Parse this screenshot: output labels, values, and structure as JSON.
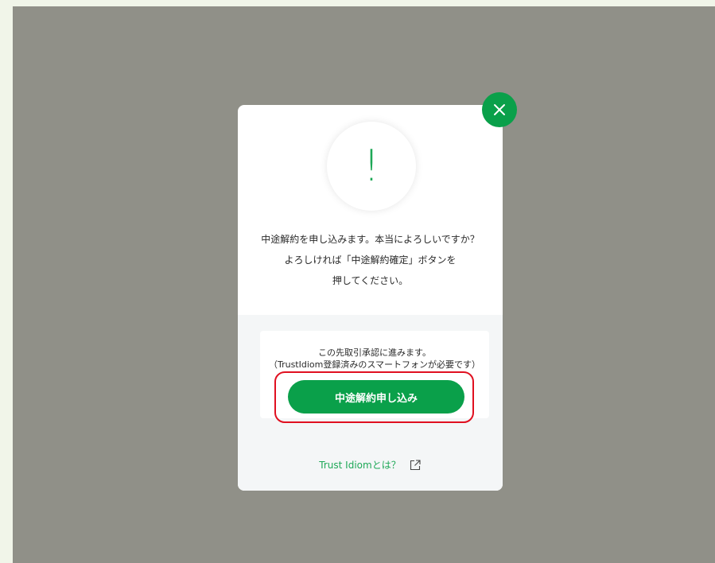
{
  "modal": {
    "alert_icon": "exclamation-icon",
    "alert_symbol": "!",
    "message_lines": [
      "中途解約を申し込みます。本当によろしいですか？",
      "よろしければ「中途解約確定」ボタンを",
      "押してください。"
    ],
    "info_lines": [
      "この先取引承認に進みます。",
      "（TrustIdiom登録済みのスマートフォンが必要です）"
    ],
    "apply_button_label": "中途解約申し込み",
    "footer_link_label": "Trust Idiomとは？",
    "footer_link_icon": "external-link-icon",
    "close_icon": "close-icon"
  },
  "colors": {
    "accent_green": "#0aa04a",
    "highlight_red": "#e01020",
    "overlay": "#909088"
  }
}
